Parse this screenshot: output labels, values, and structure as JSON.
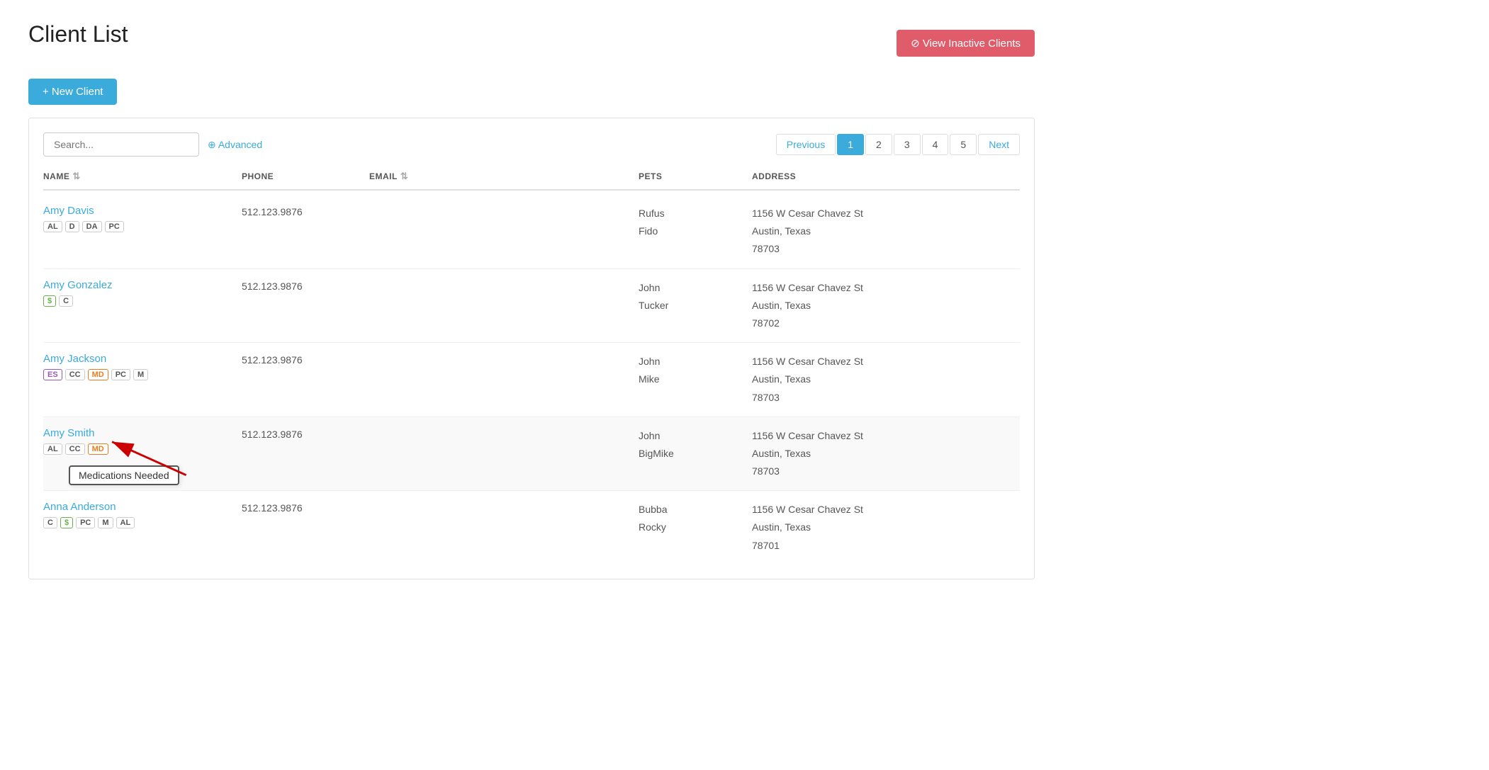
{
  "page": {
    "title": "Client List",
    "new_client_label": "+ New Client",
    "view_inactive_label": "⊘ View Inactive Clients"
  },
  "search": {
    "placeholder": "Search...",
    "advanced_label": "⊕ Advanced"
  },
  "pagination": {
    "previous_label": "Previous",
    "next_label": "Next",
    "pages": [
      "1",
      "2",
      "3",
      "4",
      "5"
    ],
    "active_page": "1"
  },
  "table": {
    "headers": [
      "NAME",
      "PHONE",
      "EMAIL",
      "PETS",
      "ADDRESS"
    ],
    "rows": [
      {
        "name": "Amy Davis",
        "badges": [
          {
            "label": "AL",
            "color": "gray"
          },
          {
            "label": "D",
            "color": "gray"
          },
          {
            "label": "DA",
            "color": "gray"
          },
          {
            "label": "PC",
            "color": "gray"
          }
        ],
        "phone": "512.123.9876",
        "email": "",
        "pets": "Rufus\nFido",
        "address": "1156 W Cesar Chavez St\nAustin, Texas\n78703"
      },
      {
        "name": "Amy Gonzalez",
        "badges": [
          {
            "label": "$",
            "color": "green"
          },
          {
            "label": "C",
            "color": "gray"
          }
        ],
        "phone": "512.123.9876",
        "email": "",
        "pets": "John\nTucker",
        "address": "1156 W Cesar Chavez St\nAustin, Texas\n78702"
      },
      {
        "name": "Amy Jackson",
        "badges": [
          {
            "label": "ES",
            "color": "purple"
          },
          {
            "label": "CC",
            "color": "gray"
          },
          {
            "label": "MD",
            "color": "orange"
          },
          {
            "label": "PC",
            "color": "gray"
          },
          {
            "label": "M",
            "color": "gray"
          }
        ],
        "phone": "512.123.9876",
        "email": "",
        "pets": "John\nMike",
        "address": "1156 W Cesar Chavez St\nAustin, Texas\n78703"
      },
      {
        "name": "Amy Smith",
        "badges": [
          {
            "label": "AL",
            "color": "gray"
          },
          {
            "label": "CC",
            "color": "gray"
          },
          {
            "label": "MD",
            "color": "orange"
          }
        ],
        "phone": "512.123.9876",
        "email": "",
        "pets": "John\nBigMike",
        "address": "1156 W Cesar Chavez St\nAustin, Texas\n78703",
        "has_tooltip": true,
        "tooltip_text": "Medications Needed",
        "highlighted": true
      },
      {
        "name": "Anna Anderson",
        "badges": [
          {
            "label": "C",
            "color": "gray"
          },
          {
            "label": "$",
            "color": "green"
          },
          {
            "label": "PC",
            "color": "gray"
          },
          {
            "label": "M",
            "color": "gray"
          },
          {
            "label": "AL",
            "color": "gray"
          }
        ],
        "phone": "512.123.9876",
        "email": "",
        "pets": "Bubba\nRocky",
        "address": "1156 W Cesar Chavez St\nAustin, Texas\n78701"
      }
    ]
  }
}
